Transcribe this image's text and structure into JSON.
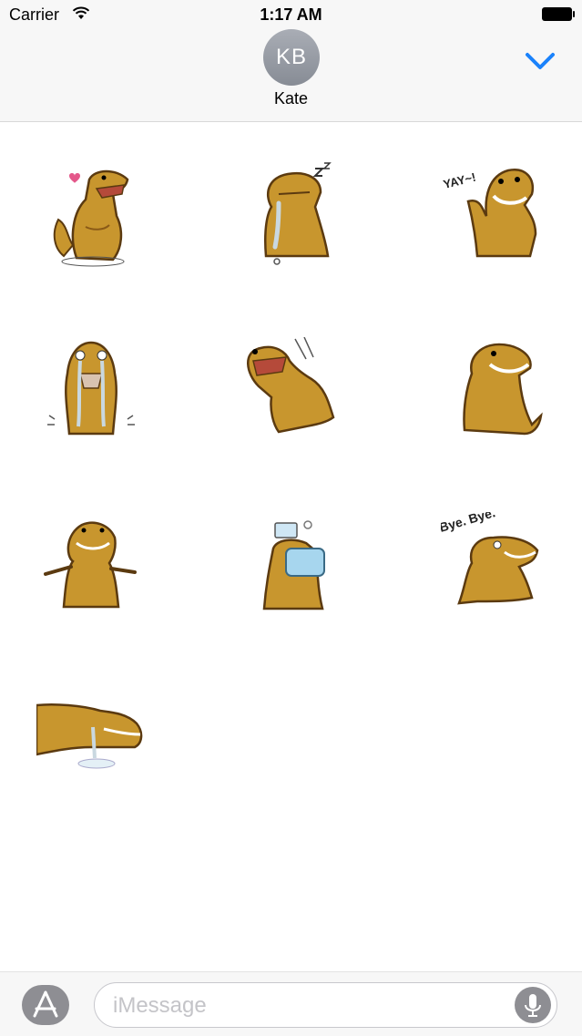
{
  "status_bar": {
    "carrier": "Carrier",
    "time": "1:17 AM"
  },
  "header": {
    "avatar_initials": "KB",
    "contact_name": "Kate",
    "collapse_icon": "chevron-down-icon"
  },
  "stickers": [
    {
      "name": "love",
      "caption": ""
    },
    {
      "name": "sleepy",
      "caption": ""
    },
    {
      "name": "yay",
      "caption": "YAY~!"
    },
    {
      "name": "crying",
      "caption": ""
    },
    {
      "name": "laughing",
      "caption": ""
    },
    {
      "name": "grin",
      "caption": ""
    },
    {
      "name": "shrug",
      "caption": ""
    },
    {
      "name": "mask",
      "caption": ""
    },
    {
      "name": "bye",
      "caption": "Bye. Bye."
    },
    {
      "name": "lying-down",
      "caption": ""
    }
  ],
  "composer": {
    "placeholder": "iMessage",
    "appstore_icon": "app-store-icon",
    "mic_icon": "microphone-icon"
  },
  "colors": {
    "accent": "#1a82fb",
    "dino": "#c8962e",
    "dino_dark": "#8a5a17",
    "bar": "#f7f7f7"
  }
}
